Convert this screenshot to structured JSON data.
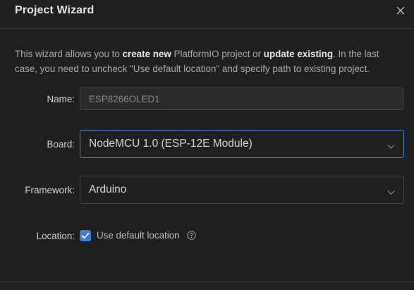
{
  "dialog": {
    "title": "Project Wizard",
    "close_icon": "close-icon"
  },
  "intro": {
    "part1": "This wizard allows you to ",
    "bold1": "create new",
    "part2": " PlatformIO project or ",
    "bold2": "update existing",
    "part3": ". In the last case, you need to uncheck \"Use default location\" and specify path to existing project."
  },
  "form": {
    "name_label": "Name:",
    "name_value": "ESP8266OLED1",
    "board_label": "Board:",
    "board_value": "NodeMCU 1.0 (ESP-12E Module)",
    "framework_label": "Framework:",
    "framework_value": "Arduino",
    "location_label": "Location:",
    "use_default_location_label": "Use default location",
    "use_default_location_checked": true
  },
  "colors": {
    "accent": "#3a7fd5",
    "background": "#1f1f1f"
  }
}
